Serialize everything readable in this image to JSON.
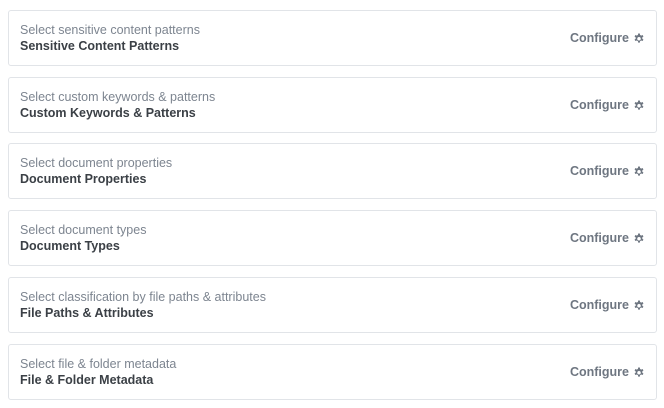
{
  "rules": [
    {
      "subtitle": "Select sensitive content patterns",
      "title": "Sensitive Content Patterns",
      "action_label": "Configure",
      "action_icon": "gear-icon"
    },
    {
      "subtitle": "Select custom keywords & patterns",
      "title": "Custom Keywords & Patterns",
      "action_label": "Configure",
      "action_icon": "gear-icon"
    },
    {
      "subtitle": "Select document properties",
      "title": "Document Properties",
      "action_label": "Configure",
      "action_icon": "gear-icon"
    },
    {
      "subtitle": "Select document types",
      "title": "Document Types",
      "action_label": "Configure",
      "action_icon": "gear-icon"
    },
    {
      "subtitle": "Select classification by file paths & attributes",
      "title": "File Paths & Attributes",
      "action_label": "Configure",
      "action_icon": "gear-icon"
    },
    {
      "subtitle": "Select file & folder metadata",
      "title": "File & Folder Metadata",
      "action_label": "Configure",
      "action_icon": "gear-icon"
    }
  ],
  "colors": {
    "border": "#e1e4e8",
    "subtitle_text": "#7d8590",
    "title_text": "#3b4046",
    "action_text": "#6e7681"
  }
}
